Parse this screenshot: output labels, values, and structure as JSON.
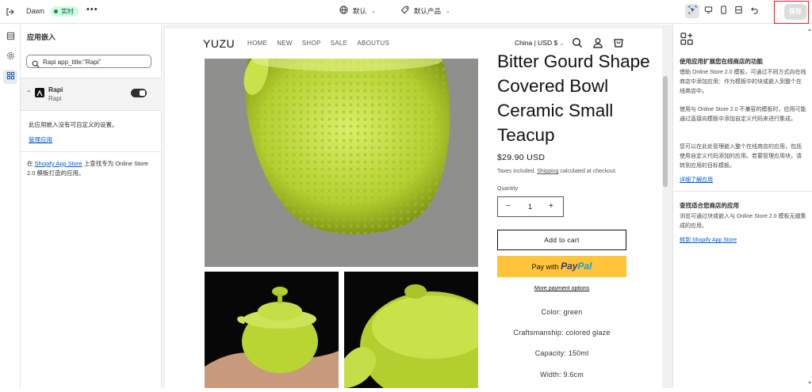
{
  "topbar": {
    "store_name": "Dawn",
    "live_badge": "实时",
    "more": "•••",
    "theme_label": "默认",
    "template_label": "默认产品",
    "save_label": "保存"
  },
  "left_panel": {
    "title": "应用嵌入",
    "search_value": "Rapi app_title:\"Rapi\"",
    "app": {
      "name": "Rapi",
      "subtitle": "Rapi"
    },
    "no_settings_note": "此应用嵌入没有可自定义的设置。",
    "manage_link": "管理应用",
    "footer_prefix": "在",
    "footer_link": "Shopify App Store",
    "footer_suffix": "上查找专为 Online Store 2.0 模板打造的应用。"
  },
  "storefront": {
    "logo": "YUZU",
    "nav": [
      "HOME",
      "NEW",
      "SHOP",
      "SALE",
      "ABOUTUS"
    ],
    "country": "China | USD $",
    "product": {
      "title": "Bitter Gourd Shape Covered Bowl Ceramic Small Teacup",
      "price": "$29.90 USD",
      "tax_prefix": "Taxes included.",
      "tax_link": "Shipping",
      "tax_suffix": "calculated at checkout.",
      "quantity_label": "Quantity",
      "quantity_value": "1",
      "add_to_cart": "Add to cart",
      "paypal_prefix": "Pay with",
      "paypal_brand_1": "Pay",
      "paypal_brand_2": "Pal",
      "more_payment": "More payment options",
      "attributes": [
        "Color: green",
        "Craftsmanship: colored glaze",
        "Capacity: 150ml",
        "Width: 9.6cm"
      ]
    }
  },
  "right_panel": {
    "section1_title": "使用应用扩展您在线商店的功能",
    "section1_p1": "借助 Online Store 2.0 模板，可通过不同方式向在线商店中添加应用：作为模板中的块或嵌入到整个在线商店中。",
    "section1_p2": "使用与 Online Store 2.0 不兼容的模板时，应用可能通过直接向模板中添加自定义代码来进行集成。",
    "section1_p3": "您可以在此处管理嵌入整个在线商店的应用，包括使用自定义代码添加的应用。若要管理应用块，请转到应用的目标模板。",
    "section1_link": "详细了解应用",
    "section2_title": "查找适合您商店的应用",
    "section2_p": "浏览可通过块或嵌入与 Online Store 2.0 模板无缝集成的应用。",
    "section2_link": "转到 Shopify App Store"
  },
  "colors": {
    "accent_link": "#005bd3",
    "live_badge_bg": "#cdfee1",
    "paypal_yellow": "#ffc439",
    "highlight_red": "#e02020",
    "product_green": "#b7d33a"
  },
  "icons": [
    "exit-icon",
    "globe-icon",
    "tag-icon",
    "inspector-icon",
    "desktop-icon",
    "mobile-icon",
    "fullscreen-icon",
    "undo-icon",
    "sections-icon",
    "settings-icon",
    "app-embed-icon",
    "search-icon",
    "cart-icon",
    "account-icon",
    "apps-add-icon"
  ]
}
